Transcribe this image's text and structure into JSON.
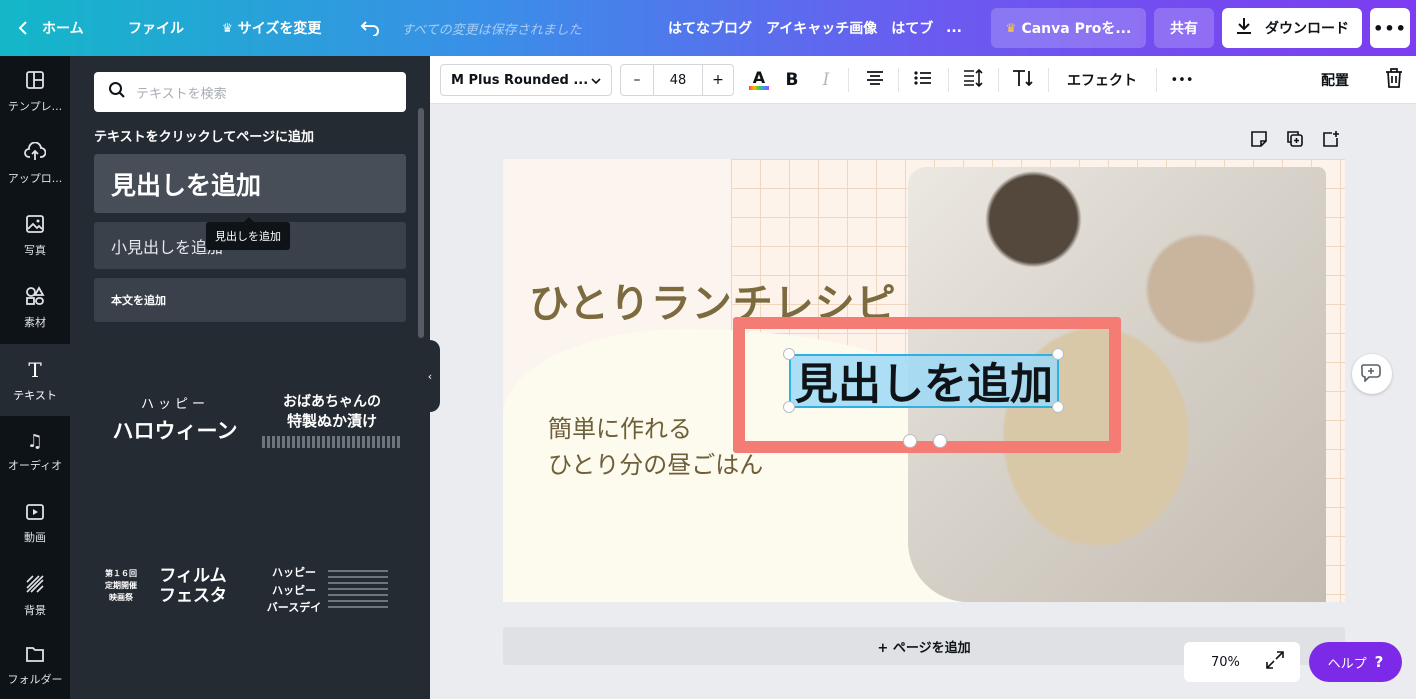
{
  "topbar": {
    "home": "ホーム",
    "file": "ファイル",
    "resize": "サイズを変更",
    "saved": "すべての変更は保存されました",
    "doc_title": "はてなブログ　アイキャッチ画像　はてブ",
    "more_title": "...",
    "pro": "Canva Proを...",
    "share": "共有",
    "download": "ダウンロード"
  },
  "rail": [
    {
      "label": "テンプレ...",
      "icon": "template-icon"
    },
    {
      "label": "アップロ...",
      "icon": "upload-icon"
    },
    {
      "label": "写真",
      "icon": "photo-icon"
    },
    {
      "label": "素材",
      "icon": "elements-icon"
    },
    {
      "label": "テキスト",
      "icon": "text-icon"
    },
    {
      "label": "オーディオ",
      "icon": "audio-icon"
    },
    {
      "label": "動画",
      "icon": "video-icon"
    },
    {
      "label": "背景",
      "icon": "background-icon"
    },
    {
      "label": "フォルダー",
      "icon": "folder-icon"
    }
  ],
  "panel": {
    "search_placeholder": "テキストを検索",
    "hint": "テキストをクリックしてページに追加",
    "add_heading": "見出しを追加",
    "add_subheading": "小見出しを追加",
    "add_body": "本文を追加",
    "tooltip": "見出しを追加",
    "templates": [
      {
        "line1": "ハッピー",
        "line2": "ハロウィーン"
      },
      {
        "line1": "おばあちゃんの",
        "line2": "特製ぬか漬け"
      },
      {
        "line1": "第１６回 定期開催 映画祭",
        "line2": "フィルム フェスタ"
      },
      {
        "line1": "ハッピー ハッピー",
        "line2": "バースデイ"
      }
    ]
  },
  "toolbar": {
    "font": "M Plus Rounded ...",
    "minus": "–",
    "size": "48",
    "plus": "+",
    "bold": "B",
    "italic": "I",
    "effects": "エフェクト",
    "arrange": "配置",
    "more": "•••"
  },
  "canvas": {
    "title": "ひとりランチレシピ",
    "subtitle_line1": "簡単に作れる",
    "subtitle_line2": "ひとり分の昼ごはん",
    "selected_text": "見出しを追加"
  },
  "footer": {
    "add_page": "+ ページを追加",
    "zoom": "70%",
    "help": "ヘルプ",
    "help_mark": "?"
  },
  "colors": {
    "accent": "#7d2ae8",
    "frame": "#f47c74",
    "title": "#7b6b3f"
  }
}
